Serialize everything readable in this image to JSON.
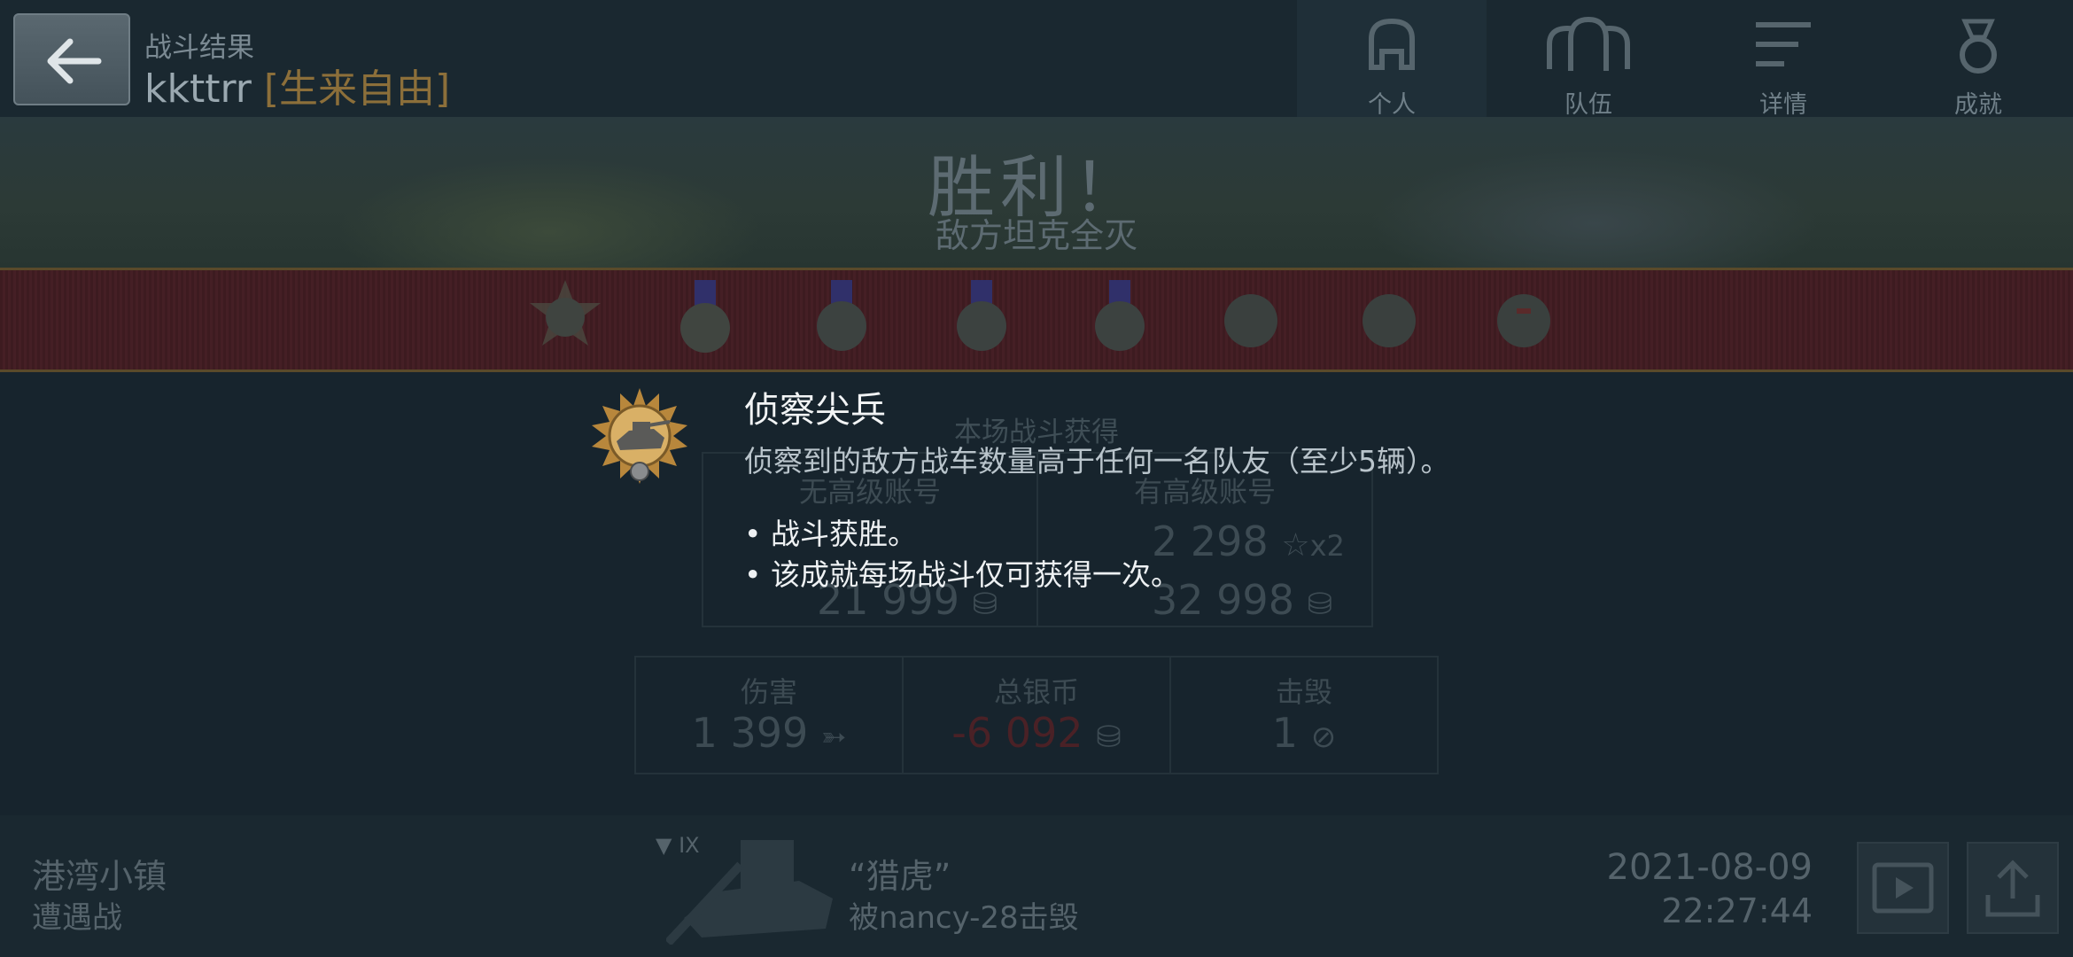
{
  "header": {
    "subtitle": "战斗结果",
    "player_name": "kkttrr",
    "clan_tag": "[生来自由]",
    "tabs": [
      {
        "label": "个人",
        "icon": "player-helmet-icon",
        "active": true
      },
      {
        "label": "队伍",
        "icon": "team-helmets-icon",
        "active": false
      },
      {
        "label": "详情",
        "icon": "details-list-icon",
        "active": false
      },
      {
        "label": "成就",
        "icon": "medal-ribbon-icon",
        "active": false
      }
    ]
  },
  "banner": {
    "result": "胜利！",
    "result_sub": "敌方坦克全灭"
  },
  "stats": {
    "earned_title": "本场战斗获得",
    "no_premium_label": "无高级账号",
    "premium_label": "有高级账号",
    "premium_xp": "2 298",
    "premium_xp_multiplier": "x2",
    "premium_credits": "32 998",
    "no_premium_credits": "21 999",
    "damage_label": "伤害",
    "damage_value": "1 399",
    "total_credits_label": "总银币",
    "total_credits_value": "-6 092",
    "kills_label": "击毁",
    "kills_value": "1"
  },
  "bottom": {
    "map_name": "港湾小镇",
    "battle_mode": "遭遇战",
    "tank_tier": "IX",
    "tank_name": "“猎虎”",
    "killed_by": "被nancy-28击毁",
    "date": "2021-08-09",
    "time": "22:27:44"
  },
  "tooltip": {
    "title": "侦察尖兵",
    "description": "侦察到的敌方战车数量高于任何一名队友（至少5辆）。",
    "bullets": [
      "• 战斗获胜。",
      "• 该成就每场战斗仅可获得一次。"
    ]
  },
  "colors": {
    "background": "#17242d",
    "ribbon": "#451f25",
    "negative": "#4a2126",
    "clan": "#8c6f3a"
  }
}
